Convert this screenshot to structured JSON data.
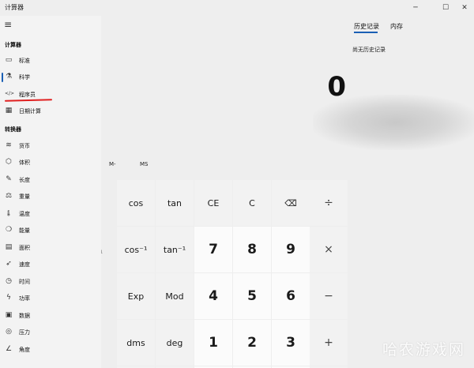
{
  "window": {
    "title": "计算器",
    "minimize": "─",
    "maximize": "☐",
    "close": "✕"
  },
  "display": {
    "value": "0"
  },
  "memory": {
    "m_minus": "M-",
    "ms": "MS"
  },
  "keypad": {
    "row1": [
      "cos",
      "tan",
      "CE",
      "C",
      "⌫",
      "÷"
    ],
    "row2": [
      "cos⁻¹",
      "tan⁻¹",
      "7",
      "8",
      "9",
      "×"
    ],
    "row3": [
      "Exp",
      "Mod",
      "4",
      "5",
      "6",
      "−"
    ],
    "row4": [
      "dms",
      "deg",
      "1",
      "2",
      "3",
      "+"
    ],
    "fragments": [
      "¹"
    ]
  },
  "history": {
    "tab_history": "历史记录",
    "tab_memory": "内存",
    "empty": "尚无历史记录"
  },
  "watermark": "哈农游戏网",
  "nav": {
    "menu_icon": "≡",
    "calculator_header": "计算器",
    "converter_header": "转换器",
    "calculators": [
      {
        "label": "标准",
        "icon": "▭"
      },
      {
        "label": "科学",
        "icon": "⚗"
      },
      {
        "label": "程序员",
        "icon": "</>"
      },
      {
        "label": "日期计算",
        "icon": "▦"
      }
    ],
    "converters": [
      {
        "label": "货币",
        "icon": "≋"
      },
      {
        "label": "体积",
        "icon": "⬡"
      },
      {
        "label": "长度",
        "icon": "✎"
      },
      {
        "label": "重量",
        "icon": "⚖"
      },
      {
        "label": "温度",
        "icon": "🌡"
      },
      {
        "label": "能量",
        "icon": "❍"
      },
      {
        "label": "面积",
        "icon": "▤"
      },
      {
        "label": "速度",
        "icon": "➶"
      },
      {
        "label": "时间",
        "icon": "◷"
      },
      {
        "label": "功率",
        "icon": "ϟ"
      },
      {
        "label": "数据",
        "icon": "▣"
      },
      {
        "label": "压力",
        "icon": "◎"
      },
      {
        "label": "角度",
        "icon": "∠"
      }
    ]
  },
  "colors": {
    "accent": "#1a5fb4",
    "annotation": "#e02020"
  }
}
